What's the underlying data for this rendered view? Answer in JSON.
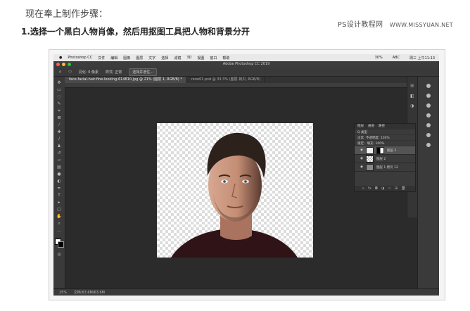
{
  "article": {
    "intro": "现在奉上制作步骤：",
    "step1": "1.选择一个黑白人物肖像，然后用抠图工具把人物和背景分开",
    "watermark": "PS设计教程网",
    "watermark_url": "WWW.MISSYUAN.NET"
  },
  "colors": {
    "ps_background": "#2b2b2b",
    "panel": "#3a3a3a",
    "traffic_red": "#ff5f57",
    "traffic_yellow": "#febc2e",
    "traffic_green": "#28c840"
  },
  "photoshop": {
    "mac_menu": [
      "Photoshop CC",
      "文件",
      "编辑",
      "图像",
      "图层",
      "文字",
      "选择",
      "滤镜",
      "3D",
      "视图",
      "窗口",
      "帮助"
    ],
    "mac_status": [
      "30%",
      "ABC",
      "周三 上午11:13"
    ],
    "window_title": "Adobe Photoshop CC 2019",
    "options": {
      "feather_label": "羽化: 0 像素",
      "style_label": "样式: 正常",
      "select_mask_button": "选择并遮住..."
    },
    "tabs": [
      {
        "label": "face-facial-hair-fine-looking-614810.jpg @ 21% (图层 1, RGB/8) *"
      },
      {
        "label": "rene01.psd @ 33.3% (图层 拷贝, RGB/8)"
      }
    ],
    "layers_panel": {
      "tabs": [
        "图层",
        "通道",
        "路径"
      ],
      "kind_label": "Q 类型",
      "blend_mode": "正常",
      "opacity_label": "不透明度: 100%",
      "lock_label": "锁定:",
      "fill_label": "填充: 100%",
      "layers": [
        {
          "name": "图层 2",
          "selected": true
        },
        {
          "name": "图层 2",
          "selected": false
        },
        {
          "name": "图层 1 拷贝 12",
          "selected": false
        }
      ]
    },
    "status": {
      "zoom": "25%",
      "doc": "文档:63.6M/63.6M"
    }
  }
}
